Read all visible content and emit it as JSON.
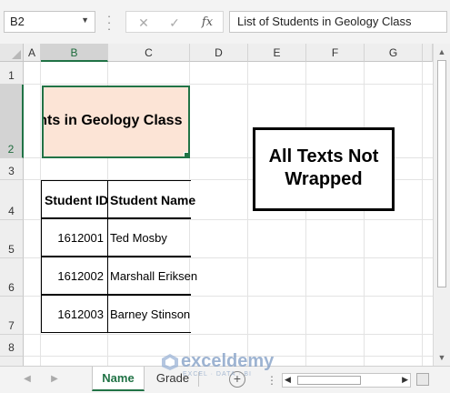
{
  "formula_bar": {
    "name_box": "B2",
    "cancel_icon": "close-icon",
    "enter_icon": "check-icon",
    "fx_label": "fx",
    "formula_text": "List of Students in Geology Class"
  },
  "columns": [
    "A",
    "B",
    "C",
    "D",
    "E",
    "F",
    "G"
  ],
  "rows": [
    "1",
    "2",
    "3",
    "4",
    "5",
    "6",
    "7",
    "8"
  ],
  "selected_cell": {
    "column": "B",
    "row": "2",
    "visible_text": "f Students in Geology Class",
    "fill_color": "#fce4d6",
    "border_color": "#217346"
  },
  "table": {
    "headers": [
      "Student ID",
      "Student Name"
    ],
    "rows": [
      [
        "1612001",
        "Ted Mosby"
      ],
      [
        "1612002",
        "Marshall Eriksen"
      ],
      [
        "1612003",
        "Barney Stinson"
      ]
    ]
  },
  "callout": {
    "line1": "All Texts Not",
    "line2": "Wrapped"
  },
  "sheet_tabs": {
    "tabs": [
      "Name",
      "Grade"
    ],
    "active": "Name",
    "add_label": "+"
  },
  "watermark": {
    "name": "exceldemy",
    "tagline": "EXCEL · DATA · BI"
  },
  "colors": {
    "accent": "#217346",
    "header_fill": "#fce4d6"
  }
}
